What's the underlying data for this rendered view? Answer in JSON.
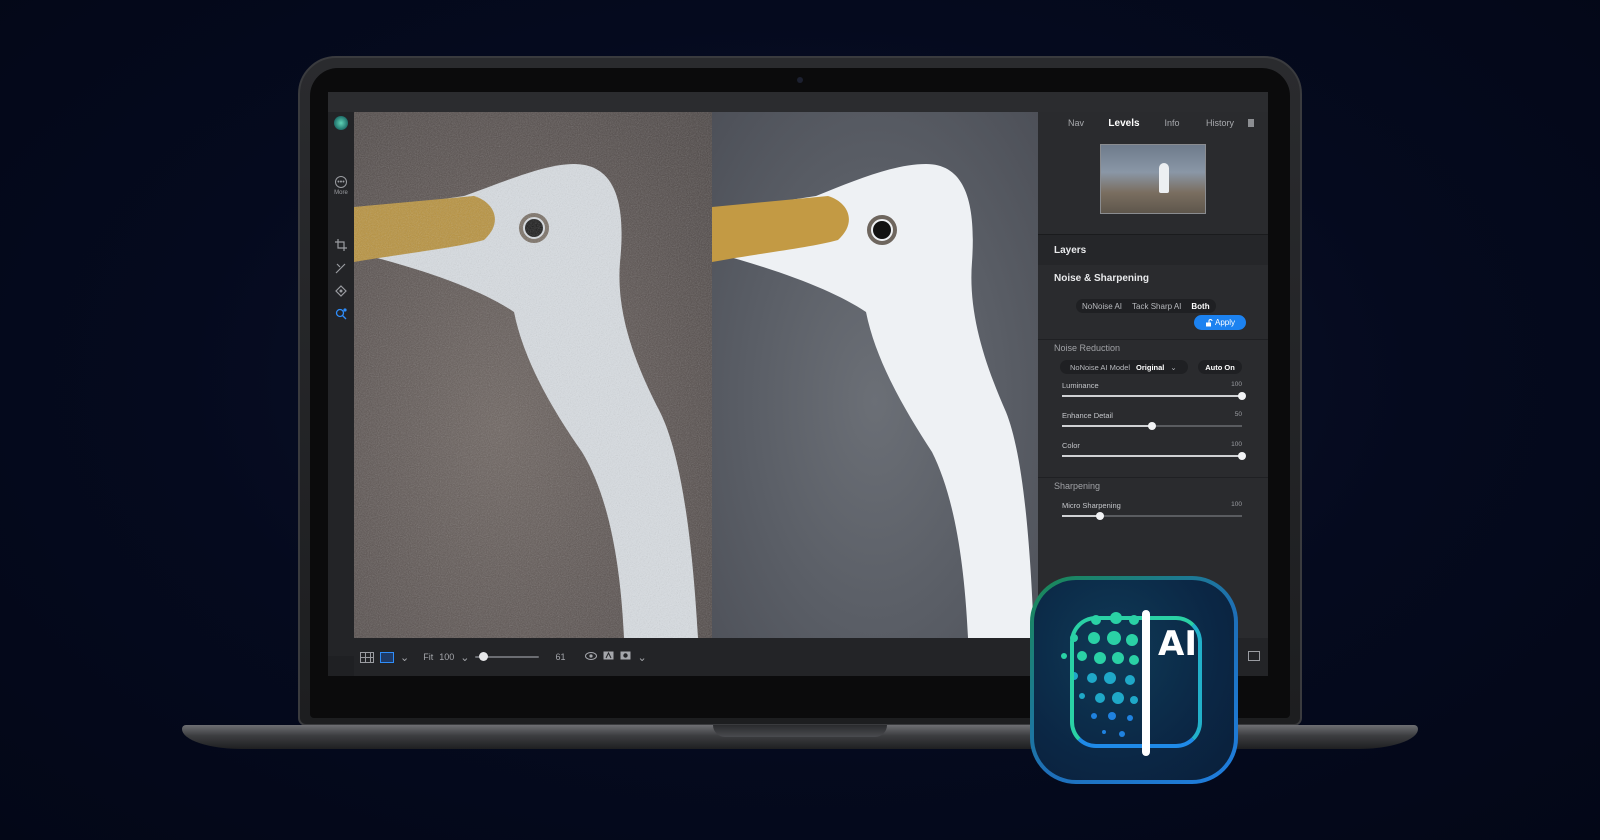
{
  "panel": {
    "tabs": [
      "Nav",
      "Levels",
      "Info",
      "History"
    ],
    "active_tab": "Levels",
    "layers_title": "Layers",
    "noise_sharpening": {
      "title": "Noise & Sharpening",
      "modes": [
        "NoNoise AI",
        "Tack Sharp AI",
        "Both"
      ],
      "selected_mode": "Both",
      "apply_label": "Apply"
    },
    "noise_reduction": {
      "title": "Noise Reduction",
      "model_label": "NoNoise AI Model",
      "model_value": "Original",
      "auto_label": "Auto On",
      "sliders": [
        {
          "label": "Luminance",
          "value": "100",
          "fraction": 1.0
        },
        {
          "label": "Enhance Detail",
          "value": "50",
          "fraction": 0.5
        },
        {
          "label": "Color",
          "value": "100",
          "fraction": 1.0
        }
      ]
    },
    "sharpening": {
      "title": "Sharpening",
      "sliders": [
        {
          "label": "Micro Sharpening",
          "value": "100",
          "fraction": 0.21
        }
      ]
    }
  },
  "toolbar": {
    "more_label": "More"
  },
  "bottom_bar": {
    "fit_label": "Fit",
    "zoom_value": "100",
    "slider_value": "61",
    "slider_fraction": 0.05
  },
  "ai_icon": {
    "text": "AI"
  },
  "colors": {
    "accent": "#1c82f0",
    "icon_green": "#2ad1a5",
    "icon_blue": "#1f8ae8",
    "background": "#050a1e"
  }
}
